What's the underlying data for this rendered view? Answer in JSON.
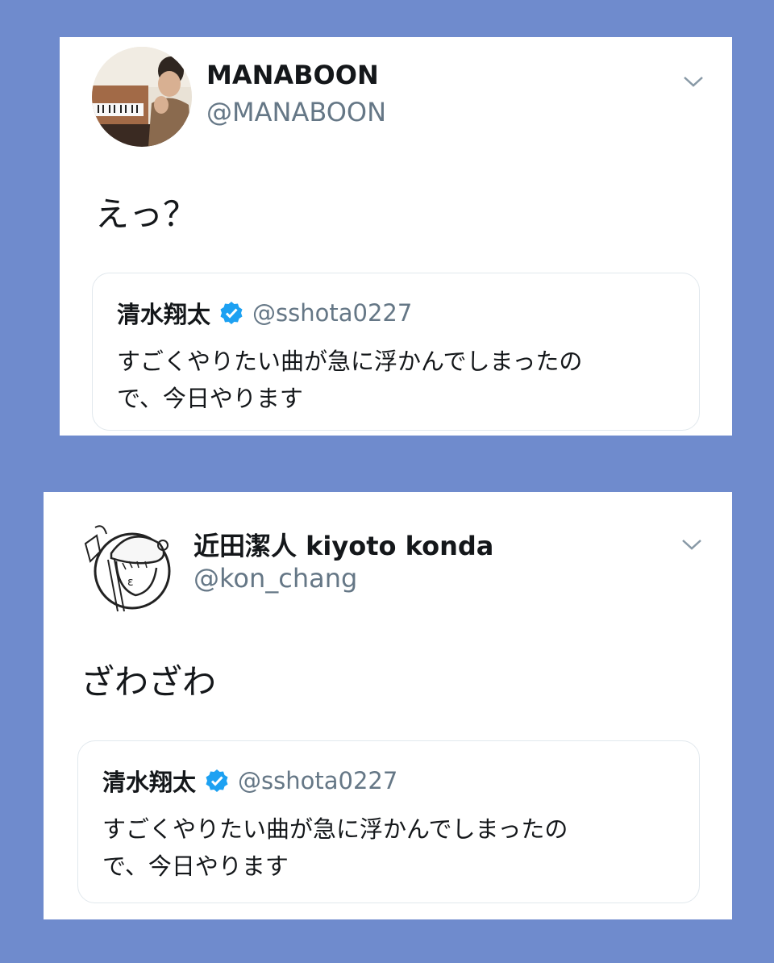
{
  "tweets": [
    {
      "display_name": "MANABOON",
      "handle": "@MANABOON",
      "text": "えっ？",
      "quote": {
        "name": "清水翔太",
        "handle": "@sshota0227",
        "text_lines": [
          "すごくやりたい曲が急に浮かんでしまったの",
          "で、今日やります"
        ]
      }
    },
    {
      "display_name": "近田潔人 kiyoto konda",
      "handle": "@kon_chang",
      "text": "ざわざわ",
      "quote": {
        "name": "清水翔太",
        "handle": "@sshota0227",
        "text_lines": [
          "すごくやりたい曲が急に浮かんでしまったの",
          "で、今日やります"
        ]
      }
    }
  ],
  "icons": [
    "chevron-down-icon",
    "verified-badge-icon"
  ],
  "colors": {
    "background": "#6f8bcd",
    "handle": "#657786",
    "verified": "#1da1f2"
  }
}
